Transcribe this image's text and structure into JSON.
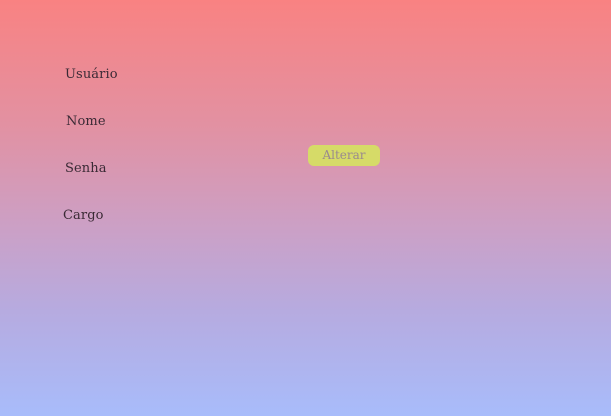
{
  "form": {
    "labels": {
      "usuario": "Usuário",
      "nome": "Nome",
      "senha": "Senha",
      "cargo": "Cargo"
    },
    "submit_label": "Alterar"
  },
  "colors": {
    "background_top": "#f98282",
    "background_bottom": "#a8bcfb",
    "button_bg": "#d6db68",
    "button_text": "#9a8a8e",
    "label_text": "#3a2a35"
  }
}
